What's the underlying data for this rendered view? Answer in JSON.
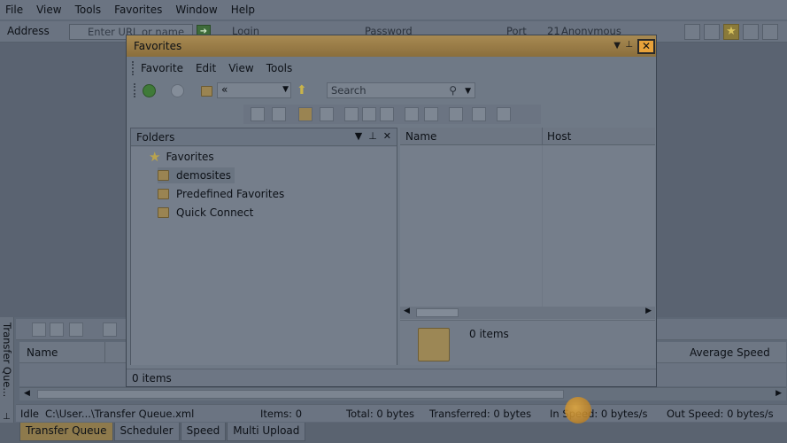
{
  "app": {
    "menu": [
      "File",
      "View",
      "Tools",
      "Favorites",
      "Window",
      "Help"
    ],
    "address": {
      "label": "Address",
      "placeholder": "Enter URL or name"
    },
    "connection": {
      "login": "Login",
      "password": "Password",
      "port_label": "Port",
      "port_value": "21",
      "anonymous": "Anonymous"
    }
  },
  "transfer_queue": {
    "side_tab": "Transfer Que...",
    "columns": {
      "name": "Name",
      "average_speed": "Average Speed"
    }
  },
  "status": {
    "state": "Idle",
    "file": "C:\\User...\\Transfer Queue.xml",
    "items": "Items: 0",
    "total": "Total: 0 bytes",
    "transferred": "Transferred: 0 bytes",
    "in_speed": "In Speed: 0 bytes/s",
    "out_speed": "Out Speed: 0 bytes/s"
  },
  "bottom_tabs": [
    "Transfer Queue",
    "Scheduler",
    "Speed",
    "Multi Upload"
  ],
  "dialog": {
    "title": "Favorites",
    "close_glyph": "✕",
    "menu": [
      "Favorite",
      "Edit",
      "View",
      "Tools"
    ],
    "path": "«",
    "search_placeholder": "Search",
    "folders": {
      "header": "Folders",
      "root": "Favorites",
      "items": [
        "demosites",
        "Predefined Favorites",
        "Quick Connect"
      ]
    },
    "files": {
      "col_name": "Name",
      "col_host": "Host",
      "count": "0 items"
    },
    "status": "0 items"
  },
  "colors": {
    "highlight_close": "#e8a23a",
    "title_bar": "#a88a52"
  }
}
